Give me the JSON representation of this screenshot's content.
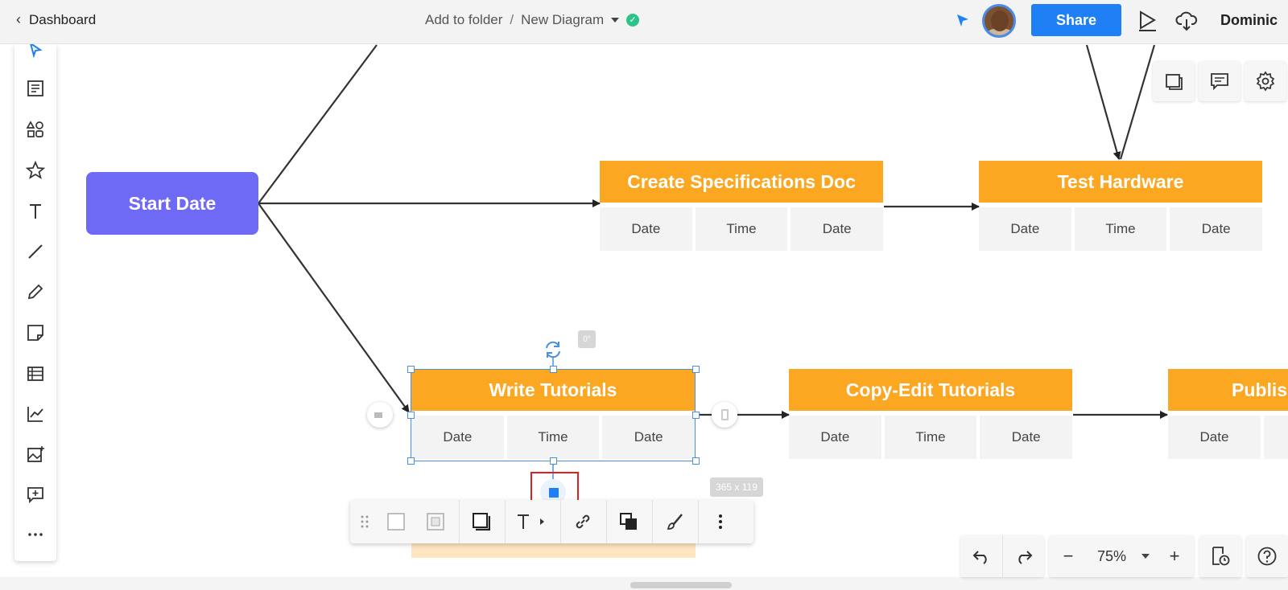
{
  "topbar": {
    "back_label": "Dashboard",
    "folder_label": "Add to folder",
    "separator": "/",
    "diagram_name": "New Diagram",
    "share_label": "Share",
    "user_name": "Dominic"
  },
  "nodes": {
    "start_label": "Start Date",
    "tasks": [
      {
        "title": "Create Specifications Doc",
        "cells": [
          "Date",
          "Time",
          "Date"
        ]
      },
      {
        "title": "Test Hardware",
        "cells": [
          "Date",
          "Time",
          "Date"
        ]
      },
      {
        "title": "Write Tutorials",
        "cells": [
          "Date",
          "Time",
          "Date"
        ]
      },
      {
        "title": "Copy-Edit Tutorials",
        "cells": [
          "Date",
          "Time",
          "Date"
        ]
      },
      {
        "title": "Publis",
        "cells": [
          "Date",
          ""
        ]
      }
    ]
  },
  "selection": {
    "angle": "0°",
    "size": "365 x 119"
  },
  "zoom": {
    "minus": "−",
    "value": "75%",
    "plus": "+"
  },
  "left_tools": [
    "select-icon",
    "text-block-icon",
    "shapes-icon",
    "star-icon",
    "text-icon",
    "line-icon",
    "pencil-icon",
    "sticky-note-icon",
    "table-icon",
    "chart-icon",
    "image-icon",
    "comment-add-icon",
    "more-icon"
  ],
  "colors": {
    "accent": "#1f80f5",
    "task_header": "#fba722",
    "start_node": "#6f6af6",
    "cell_bg": "#f3f3f3",
    "selection": "#4a90e2",
    "highlight": "#e02020"
  }
}
